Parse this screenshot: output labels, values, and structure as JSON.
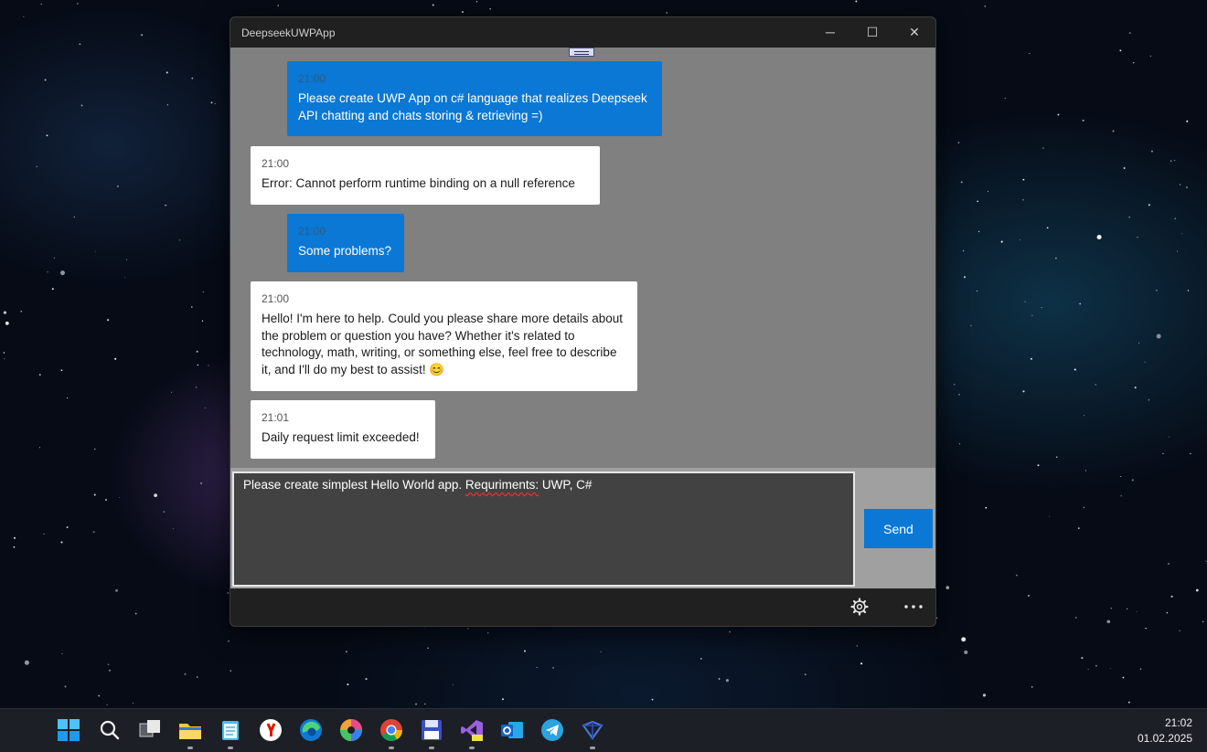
{
  "window": {
    "title": "DeepseekUWPApp",
    "controls": {
      "minimize": "─",
      "maximize": "☐",
      "close": "✕"
    }
  },
  "messages": [
    {
      "role": "user",
      "time": "21:00",
      "text": "Please create UWP App on c# language that realizes Deepseek API chatting and chats storing & retrieving =)"
    },
    {
      "role": "assistant",
      "time": "21:00",
      "text": "Error: Cannot perform runtime binding on a null reference"
    },
    {
      "role": "user",
      "time": "21:00",
      "text": "Some problems?"
    },
    {
      "role": "assistant",
      "time": "21:00",
      "text": "Hello! I'm here to help. Could you please share more details about the problem or question you have? Whether it's related to technology, math, writing, or something else, feel free to describe it, and I'll do my best to assist! 😊"
    },
    {
      "role": "assistant",
      "time": "21:01",
      "text": "Daily request limit exceeded!"
    }
  ],
  "input": {
    "value_before": "Please create simplest Hello World app. ",
    "value_misspelled": "Requriments:",
    "value_after": " UWP, C#"
  },
  "send_label": "Send",
  "command_bar": {
    "settings_icon": "gear-icon",
    "more_icon": "more-icon"
  },
  "colors": {
    "accent": "#0a78d4",
    "chat_bg": "#808080",
    "titlebar": "#202020"
  },
  "taskbar": {
    "apps": [
      "start",
      "search",
      "task-view",
      "file-explorer",
      "notepad",
      "yandex-browser",
      "edge",
      "color-app",
      "chrome",
      "save-app",
      "visual-studio-preview",
      "outlook",
      "telegram",
      "network-app"
    ],
    "time": "21:02",
    "date": "01.02.2025"
  }
}
